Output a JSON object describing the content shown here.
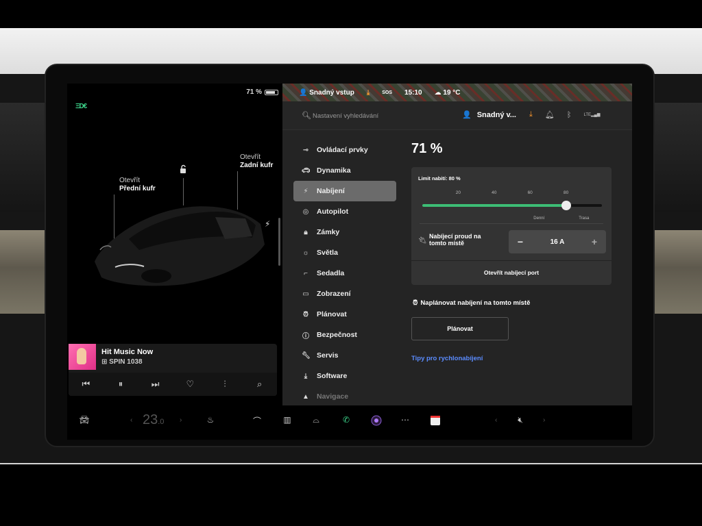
{
  "left_panel": {
    "battery_pct": "71 %",
    "battery_level": 0.71,
    "headlight_icon": "headlight-icon",
    "front_trunk": {
      "action": "Otevřít",
      "name": "Přední kufr"
    },
    "rear_trunk": {
      "action": "Otevřít",
      "name": "Zadní kufr"
    },
    "music": {
      "title": "Hit Music Now",
      "station": "SPIN 1038"
    }
  },
  "top_strip": {
    "profile": "Snadný vstup",
    "sos": "SOS",
    "time": "15:10",
    "temperature": "19 °C"
  },
  "search": {
    "placeholder": "Nastavení vyhledávání"
  },
  "header": {
    "profile_label": "Snadný v...",
    "signal": "LTE"
  },
  "menu": {
    "items": [
      {
        "label": "Ovládací prvky",
        "icon": "toggle-icon"
      },
      {
        "label": "Dynamika",
        "icon": "car-icon"
      },
      {
        "label": "Nabíjení",
        "icon": "bolt-icon"
      },
      {
        "label": "Autopilot",
        "icon": "steering-wheel-icon"
      },
      {
        "label": "Zámky",
        "icon": "lock-icon"
      },
      {
        "label": "Světla",
        "icon": "sun-icon"
      },
      {
        "label": "Sedadla",
        "icon": "seat-icon"
      },
      {
        "label": "Zobrazení",
        "icon": "display-icon"
      },
      {
        "label": "Plánovat",
        "icon": "alarm-icon"
      },
      {
        "label": "Bezpečnost",
        "icon": "alert-icon"
      },
      {
        "label": "Servis",
        "icon": "wrench-icon"
      },
      {
        "label": "Software",
        "icon": "download-icon"
      },
      {
        "label": "Navigace",
        "icon": "navigation-icon"
      }
    ],
    "active_index": 2
  },
  "charging": {
    "battery_pct": "71 %",
    "limit_label": "Limit nabití: 80 %",
    "limit_value": 80,
    "ticks": [
      "20",
      "40",
      "60",
      "80"
    ],
    "range_daily": "Denní",
    "range_trip": "Trasa",
    "current_label": "Nabíjecí proud na tomto místě",
    "current_value": "16 A",
    "open_port": "Otevřít nabíjecí port",
    "schedule_label": "Naplánovat nabíjení na tomto místě",
    "schedule_button": "Plánovat",
    "tips_link": "Tipy pro rychlonabíjení"
  },
  "bottom_bar": {
    "temperature": "23",
    "temperature_decimal": ".0"
  },
  "colors": {
    "accent_green": "#3dbd75",
    "link_blue": "#5b8cff",
    "active_menu": "#6b6b6b"
  }
}
